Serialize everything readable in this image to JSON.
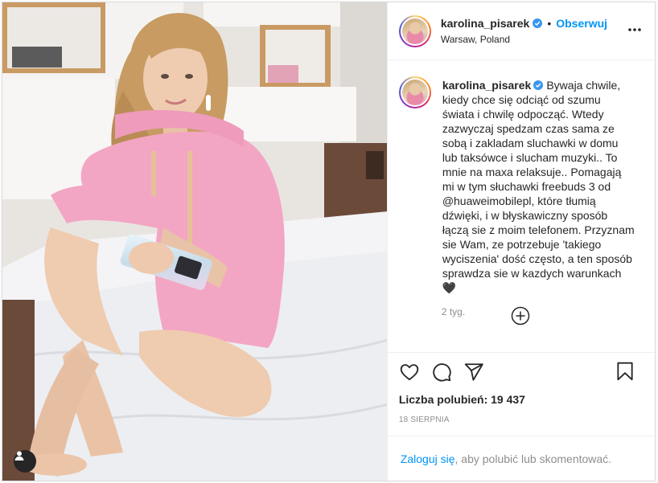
{
  "header": {
    "username": "karolina_pisarek",
    "separator": "•",
    "follow_label": "Obserwuj",
    "location": "Warsaw, Poland"
  },
  "caption": {
    "username": "karolina_pisarek",
    "text": "Bywaja chwile, kiedy chce się odciąć od szumu świata i chwilę odpocząć. Wtedy zazwyczaj spedzam czas sama ze sobą i zakladam sluchawki w domu lub taksówce i slucham muzyki.. To mnie na maxa relaksuje.. Pomagają mi w tym słuchawki freebuds 3 od @huaweimobilepl, które tłumią dźwięki, i w błyskawiczny sposób łączą sie z moim telefonem. Przyznam sie Wam, ze potrzebuje 'takiego wyciszenia' dość często, a ten sposób sprawdza sie w kazdych warunkach 🖤",
    "time_ago": "2 tyg."
  },
  "stats": {
    "likes": "Liczba polubień: 19 437",
    "date": "18 SIERPNIA"
  },
  "login_prompt": {
    "link": "Zaloguj się",
    "rest": ", aby polubić lub skomentować."
  },
  "icons": {
    "verified": "verified-badge-icon",
    "more": "more-options-icon",
    "load_more": "plus-circle-icon",
    "like": "heart-icon",
    "comment": "comment-icon",
    "share": "share-icon",
    "save": "bookmark-icon",
    "tags": "user-tag-icon"
  },
  "colors": {
    "accent": "#0095f6",
    "verified": "#3897f0",
    "text": "#262626",
    "muted": "#8e8e8e",
    "border": "#dbdbdb",
    "hoodie": "#f3a6c3"
  }
}
